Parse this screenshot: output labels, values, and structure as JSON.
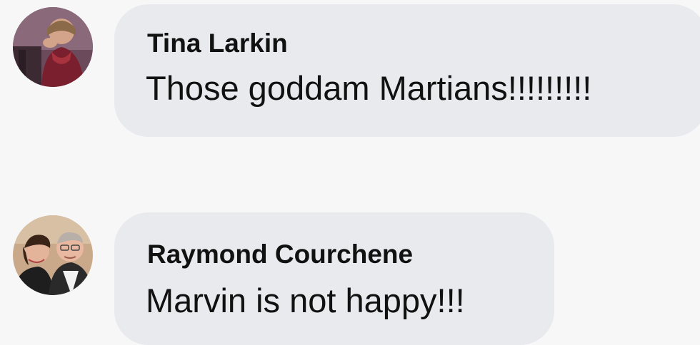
{
  "comments": [
    {
      "author": "Tina Larkin",
      "text": "Those goddam Martians!!!!!!!!!",
      "avatar_icon": "profile-photo-icon"
    },
    {
      "author": "Raymond Courchene",
      "text": "Marvin is not happy!!!",
      "avatar_icon": "profile-photo-icon"
    }
  ],
  "colors": {
    "background": "#f7f7f8",
    "bubble": "#e9eaee",
    "text": "#111111"
  }
}
